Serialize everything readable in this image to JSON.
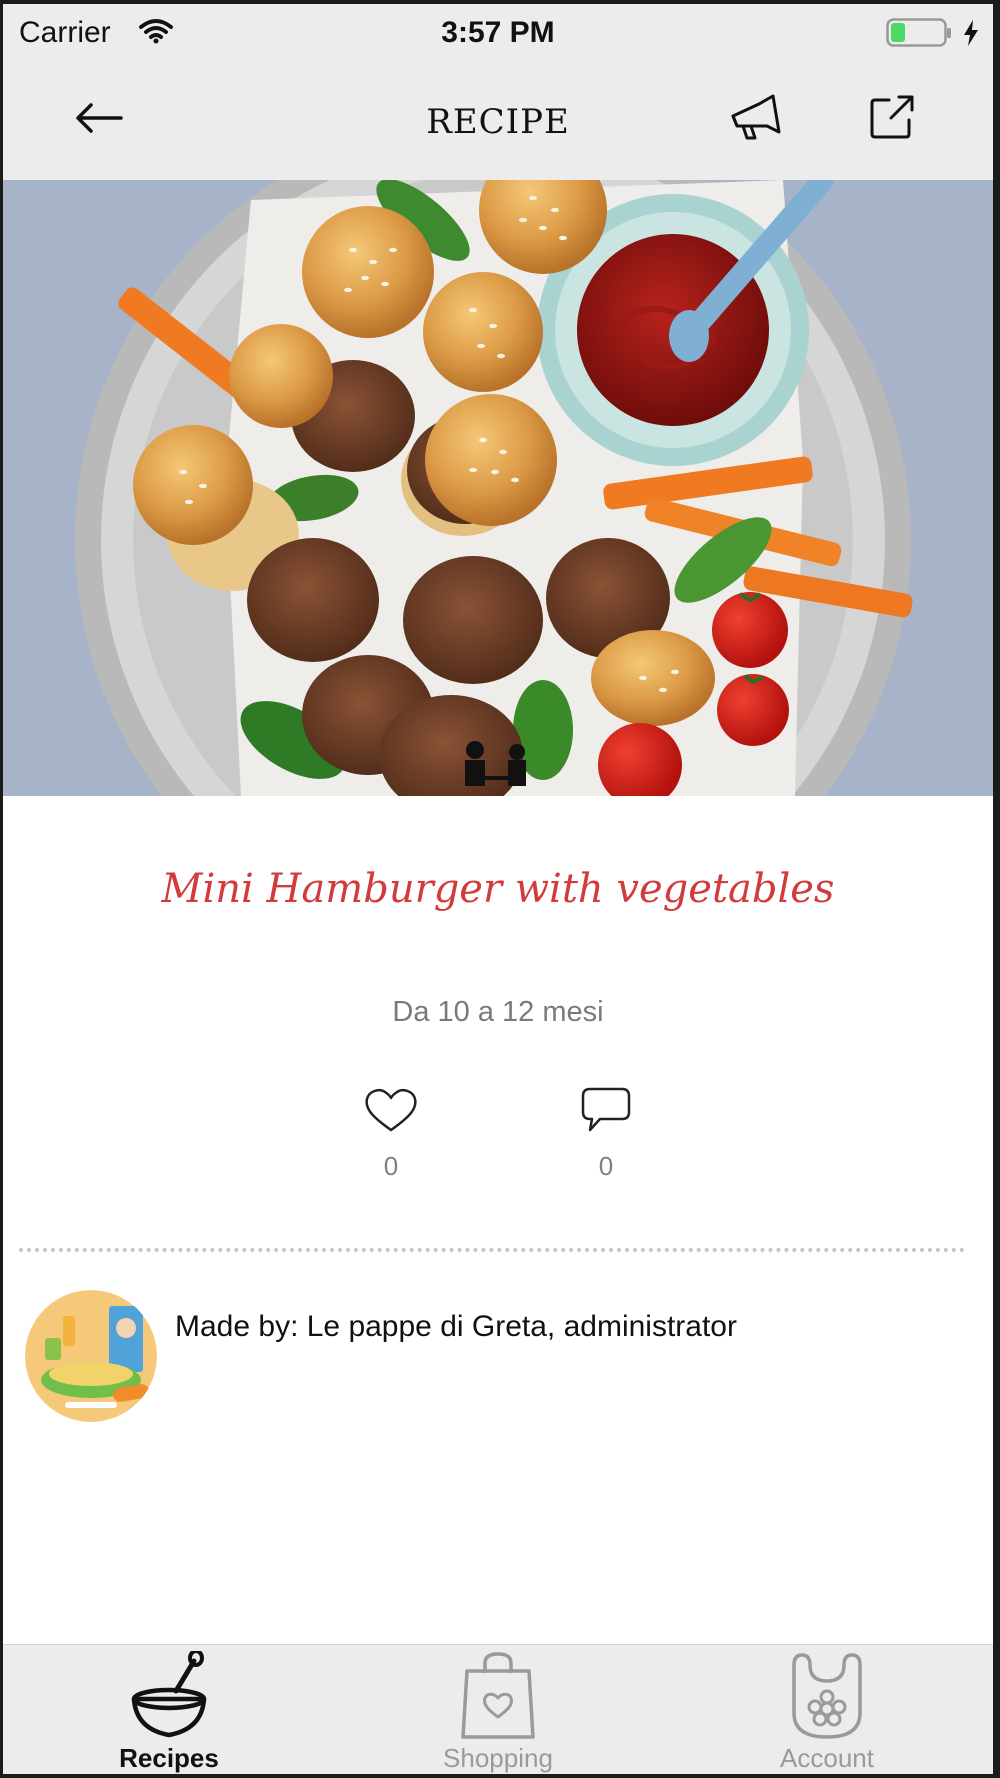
{
  "status_bar": {
    "carrier": "Carrier",
    "time": "3:57 PM",
    "wifi_icon": "wifi-icon",
    "battery_icon": "battery-icon",
    "charging_icon": "bolt-icon"
  },
  "nav": {
    "title": "RECIPE",
    "back_icon": "arrow-left-icon",
    "announce_icon": "megaphone-icon",
    "share_icon": "share-icon"
  },
  "recipe": {
    "title": "Mini Hamburger with vegetables",
    "age_range": "Da 10 a 12 mesi",
    "likes": "0",
    "comments": "0",
    "author": "Made by: Le pappe di Greta, administrator"
  },
  "tabs": [
    {
      "label": "Recipes",
      "icon": "bowl-icon",
      "active": true
    },
    {
      "label": "Shopping",
      "icon": "shopping-bag-icon",
      "active": false
    },
    {
      "label": "Account",
      "icon": "bib-icon",
      "active": false
    }
  ],
  "colors": {
    "bar_background": "#ececec",
    "title_red": "#d23b3b",
    "inactive_tab": "#9a9a9a",
    "battery_green": "#4cd964"
  }
}
